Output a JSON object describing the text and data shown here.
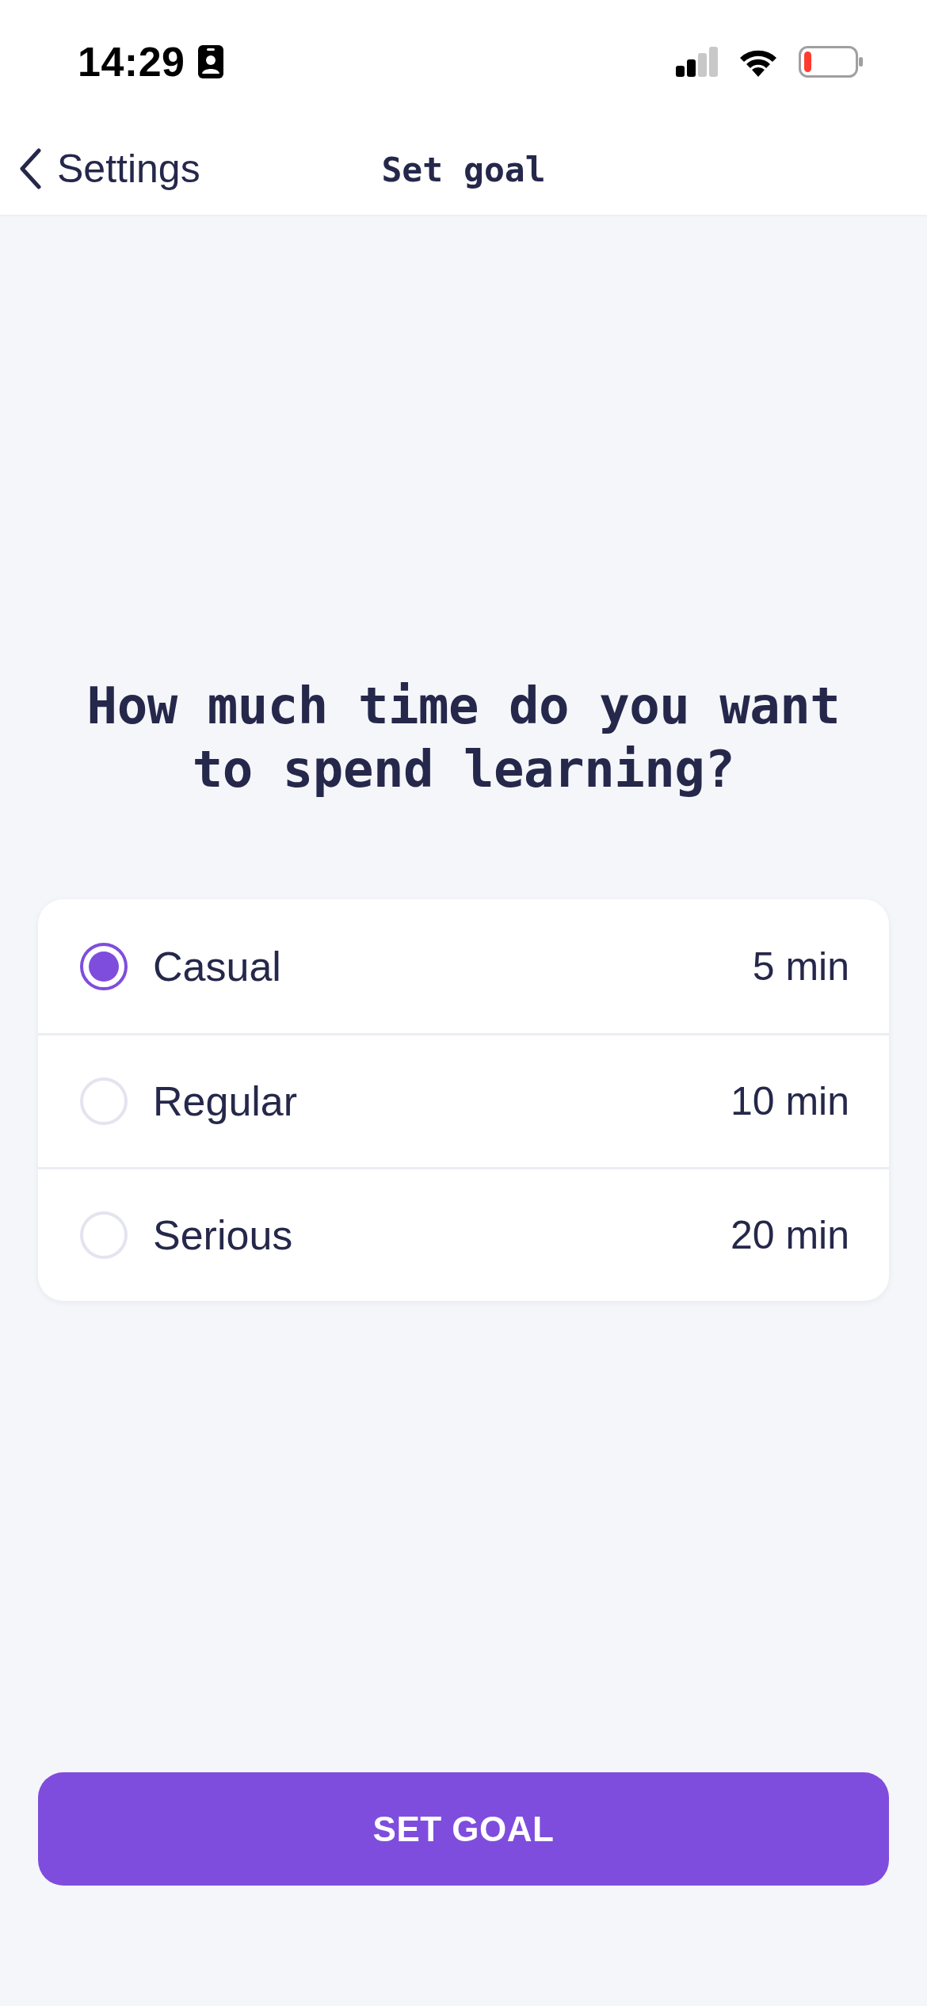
{
  "status_bar": {
    "time": "14:29"
  },
  "nav": {
    "back_label": "Settings",
    "title": "Set goal"
  },
  "heading": "How much time do you want to spend learning?",
  "options": [
    {
      "label": "Casual",
      "duration": "5 min",
      "selected": true
    },
    {
      "label": "Regular",
      "duration": "10 min",
      "selected": false
    },
    {
      "label": "Serious",
      "duration": "20 min",
      "selected": false
    }
  ],
  "primary_button": {
    "label": "SET GOAL"
  }
}
